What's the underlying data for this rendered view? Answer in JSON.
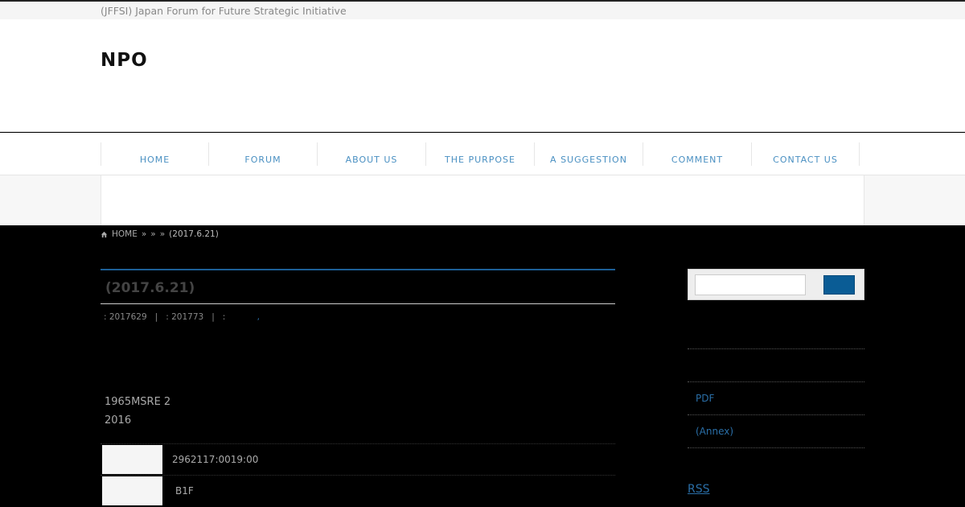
{
  "header": {
    "tagline": "(JFFSI) Japan Forum for Future Strategic Initiative",
    "site_title": "NPO"
  },
  "nav": {
    "items": [
      {
        "label": "HOME"
      },
      {
        "label": "FORUM"
      },
      {
        "label": "ABOUT US"
      },
      {
        "label": "THE PURPOSE"
      },
      {
        "label": "A SUGGESTION"
      },
      {
        "label": "COMMENT"
      },
      {
        "label": "CONTACT US"
      }
    ]
  },
  "breadcrumb": {
    "home": "HOME",
    "sep1": "»",
    "sep2": "»",
    "sep3": "»",
    "current": "(2017.6.21)"
  },
  "post": {
    "title": "(2017.6.21)",
    "meta_posted": ": 2017629",
    "meta_sep1": "|",
    "meta_updated": ": 201773",
    "meta_sep2": "|",
    "meta_category_label": ":",
    "meta_category_link": ",",
    "body_line1": "1965MSRE 2",
    "body_line2": "2016",
    "info_rows": [
      {
        "value": "2962117:0019:00"
      },
      {
        "value": "B1F"
      }
    ]
  },
  "sidebar": {
    "link_pdf": "PDF",
    "link_annex": "(Annex)",
    "rss": "RSS"
  },
  "colors": {
    "accent": "#0a5c95",
    "link": "#2a6fa8",
    "nav_text": "#4a90c2"
  }
}
